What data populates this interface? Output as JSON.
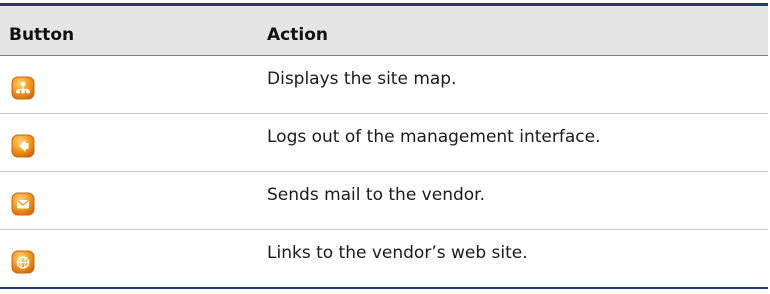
{
  "table": {
    "headers": {
      "button": "Button",
      "action": "Action"
    },
    "rows": [
      {
        "icon": "site-map-icon",
        "action": "Displays the site map."
      },
      {
        "icon": "logout-icon",
        "action": "Logs out of the management interface."
      },
      {
        "icon": "mail-icon",
        "action": "Sends mail to the vendor."
      },
      {
        "icon": "web-globe-icon",
        "action": "Links to the vendor’s web site."
      }
    ]
  },
  "colors": {
    "rule": "#1f3d73",
    "header_bg": "#e5e5e5",
    "icon_orange": "#f39a1e"
  }
}
